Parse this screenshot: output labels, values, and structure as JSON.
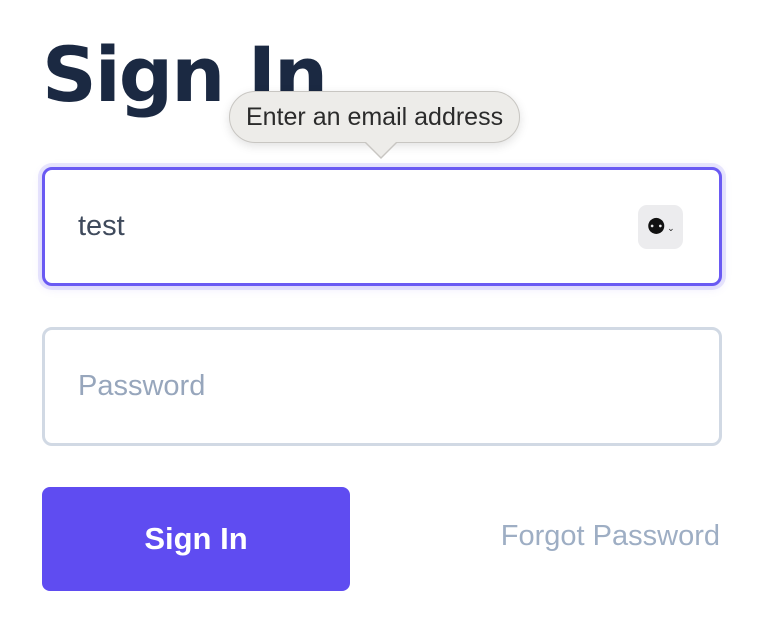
{
  "heading": "Sign In",
  "email_field": {
    "value": "test",
    "tooltip": "Enter an email address",
    "password_manager_icon": "key-icon"
  },
  "password_field": {
    "value": "",
    "placeholder": "Password"
  },
  "submit_button": {
    "label": "Sign In"
  },
  "forgot_link": {
    "label": "Forgot Password"
  },
  "colors": {
    "accent": "#5f4cf1",
    "focus_border": "#6a5af3",
    "heading": "#1b2942",
    "muted": "#9eaec4",
    "input_border": "#d1d9e4"
  }
}
